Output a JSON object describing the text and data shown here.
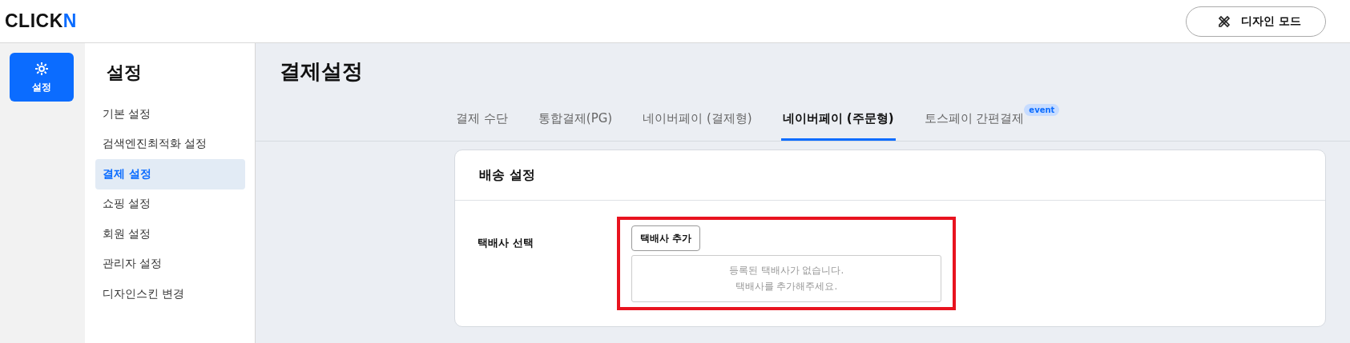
{
  "header": {
    "logo": {
      "main": "CLICK",
      "accent": "N"
    },
    "design_mode_button": "디자인 모드"
  },
  "rail": [
    {
      "label": "설정",
      "selected": true
    }
  ],
  "sidebar": {
    "title": "설정",
    "items": [
      {
        "label": "기본 설정",
        "selected": false
      },
      {
        "label": "검색엔진최적화 설정",
        "selected": false
      },
      {
        "label": "결제 설정",
        "selected": true
      },
      {
        "label": "쇼핑 설정",
        "selected": false
      },
      {
        "label": "회원 설정",
        "selected": false
      },
      {
        "label": "관리자 설정",
        "selected": false
      },
      {
        "label": "디자인스킨 변경",
        "selected": false
      }
    ]
  },
  "page_title": "결제설정",
  "tabs": [
    {
      "label": "결제 수단",
      "selected": false
    },
    {
      "label": "통합결제(PG)",
      "selected": false
    },
    {
      "label": "네이버페이 (결제형)",
      "selected": false
    },
    {
      "label": "네이버페이 (주문형)",
      "selected": true
    },
    {
      "label": "토스페이 간편결제",
      "selected": false,
      "badge": "event"
    }
  ],
  "card": {
    "title": "배송 설정",
    "field_label": "택배사 선택",
    "add_button": "택배사 추가",
    "empty_message": [
      "등록된 택배사가 없습니다.",
      "택배사를 추가해주세요."
    ],
    "highlighted": true
  }
}
